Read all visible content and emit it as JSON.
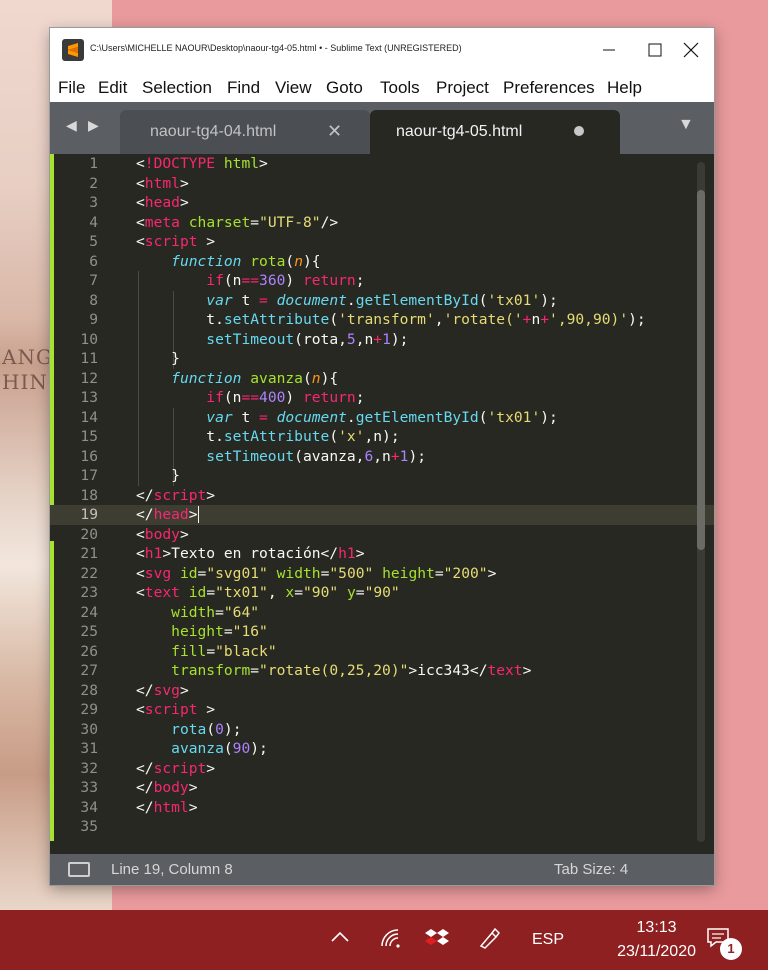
{
  "window": {
    "title": "C:\\Users\\MICHELLE NAOUR\\Desktop\\naour-tg4-05.html • - Sublime Text (UNREGISTERED)"
  },
  "menu": [
    "File",
    "Edit",
    "Selection",
    "Find",
    "View",
    "Goto",
    "Tools",
    "Project",
    "Preferences",
    "Help"
  ],
  "tabs": [
    {
      "label": "naour-tg4-04.html",
      "active": false
    },
    {
      "label": "naour-tg4-05.html",
      "active": true,
      "modified": true
    }
  ],
  "editor": {
    "active_line": 19,
    "lines": [
      "1",
      "2",
      "3",
      "4",
      "5",
      "6",
      "7",
      "8",
      "9",
      "10",
      "11",
      "12",
      "13",
      "14",
      "15",
      "16",
      "17",
      "18",
      "19",
      "20",
      "21",
      "22",
      "23",
      "24",
      "25",
      "26",
      "27",
      "28",
      "29",
      "30",
      "31",
      "32",
      "33",
      "34",
      "35"
    ]
  },
  "status": {
    "position": "Line 19, Column 8",
    "tab_size": "Tab Size: 4"
  },
  "taskbar": {
    "language": "ESP",
    "time": "13:13",
    "date": "23/11/2020",
    "notification_count": "1"
  },
  "colors": {
    "editor_bg": "#272822",
    "tag": "#f92672",
    "attribute": "#a6e22e",
    "string": "#e6db74",
    "keyword": "#66d9ef",
    "number": "#ae81ff",
    "taskbar": "#8f2021",
    "desktop": "#e89a9c"
  },
  "desktop_text": {
    "left_1": "ANG",
    "left_2": "HING"
  }
}
